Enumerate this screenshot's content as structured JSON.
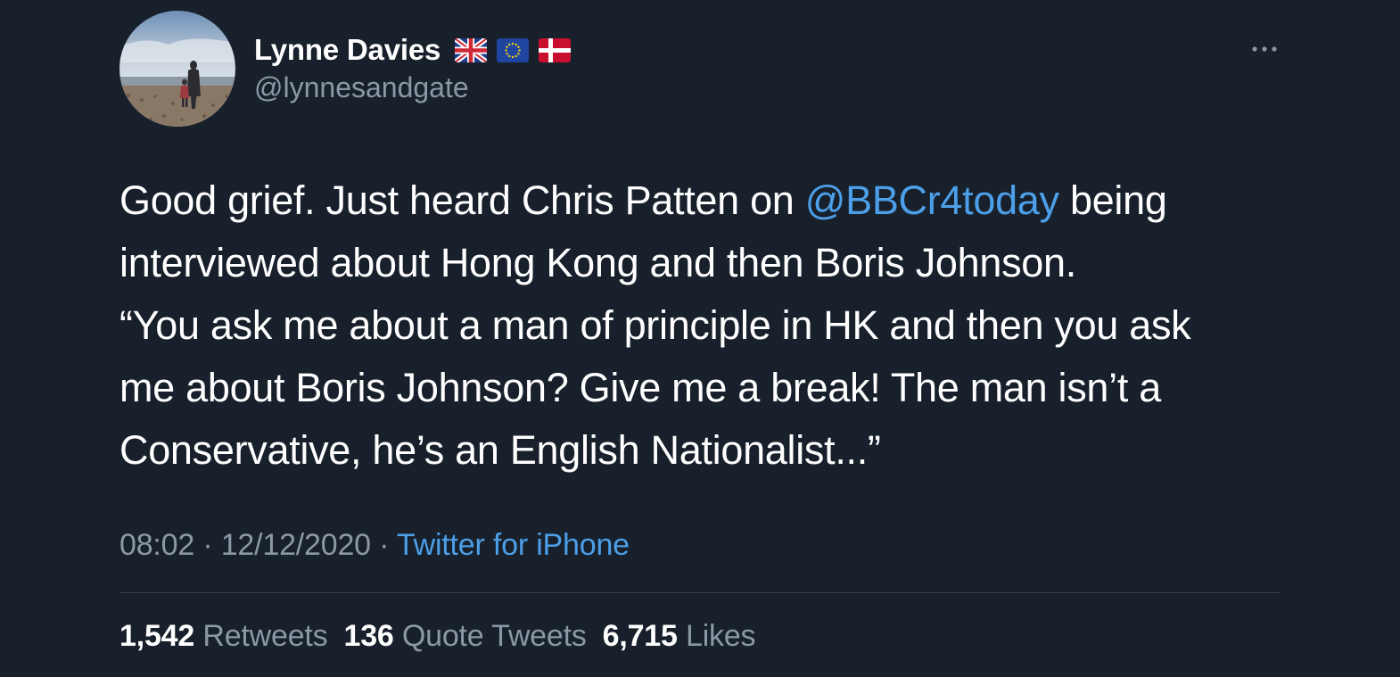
{
  "user": {
    "display_name": "Lynne Davies",
    "flag_icons": [
      "uk-flag-icon",
      "eu-flag-icon",
      "denmark-flag-icon"
    ],
    "handle": "@lynnesandgate"
  },
  "tweet": {
    "lines": [
      {
        "before": "Good grief. Just heard Chris Patten on ",
        "mention": "@BBCr4today",
        "after": " being"
      },
      {
        "text": "interviewed about Hong Kong and then Boris Johnson."
      },
      {
        "text": "“You ask me about a man of principle in HK and then you ask"
      },
      {
        "text": "me about Boris Johnson? Give me a break! The man isn’t a"
      },
      {
        "text": "Conservative, he’s an English Nationalist...”"
      }
    ],
    "time": "08:02",
    "date": "12/12/2020",
    "separator": "·",
    "source": "Twitter for iPhone"
  },
  "stats": {
    "retweets_count": "1,542",
    "retweets_label": "Retweets",
    "quotes_count": "136",
    "quotes_label": "Quote Tweets",
    "likes_count": "6,715",
    "likes_label": "Likes"
  },
  "colors": {
    "background": "#17202b",
    "text": "#ffffff",
    "secondary_text": "#8b98a5",
    "link": "#4c9fe8",
    "divider": "#38444d"
  },
  "icons": {
    "more": "more-options-icon"
  }
}
